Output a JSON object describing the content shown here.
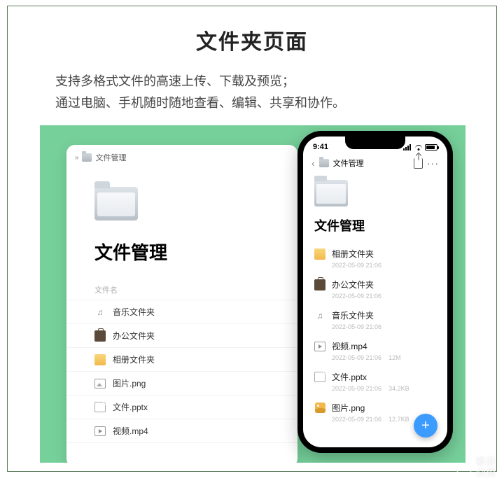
{
  "promo": {
    "heading": "文件夹页面",
    "line1": "支持多格式文件的高速上传、下载及预览；",
    "line2": "通过电脑、手机随时随地查看、编辑、共享和协作。"
  },
  "desktop": {
    "breadcrumb_label": "文件管理",
    "title": "文件管理",
    "column_header": "文件名",
    "rows": [
      {
        "icon": "music",
        "name": "音乐文件夹"
      },
      {
        "icon": "work",
        "name": "办公文件夹"
      },
      {
        "icon": "album",
        "name": "相册文件夹"
      },
      {
        "icon": "image",
        "name": "图片.png"
      },
      {
        "icon": "file",
        "name": "文件.pptx"
      },
      {
        "icon": "video",
        "name": "视频.mp4"
      }
    ]
  },
  "phone": {
    "status_time": "9:41",
    "breadcrumb_label": "文件管理",
    "title": "文件管理",
    "more_label": "···",
    "rows": [
      {
        "icon": "album",
        "name": "相册文件夹",
        "time": "2022-05-09 21:06",
        "size": ""
      },
      {
        "icon": "work",
        "name": "办公文件夹",
        "time": "2022-05-09 21:06",
        "size": ""
      },
      {
        "icon": "music",
        "name": "音乐文件夹",
        "time": "2022-05-09 21:06",
        "size": ""
      },
      {
        "icon": "video",
        "name": "视频.mp4",
        "time": "2022-05-09 21:06",
        "size": "12M"
      },
      {
        "icon": "file",
        "name": "文件.pptx",
        "time": "2022-05-09 21:06",
        "size": "34.2KB"
      },
      {
        "icon": "image",
        "name": "图片.png",
        "time": "2022-05-09 21:06",
        "size": "12.7KB"
      }
    ],
    "fab_label": "+"
  },
  "watermark": {
    "line1": "新浪",
    "line2": "众测"
  }
}
